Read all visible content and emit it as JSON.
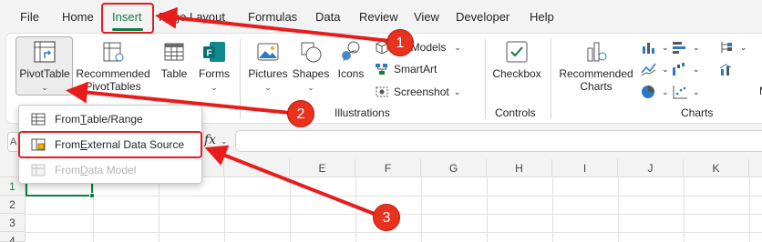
{
  "tabs": [
    "File",
    "Home",
    "Insert",
    "Page Layout",
    "Formulas",
    "Data",
    "Review",
    "View",
    "Developer",
    "Help"
  ],
  "active_tab": "Insert",
  "ribbon": {
    "pivot_table": "PivotTable",
    "recommended_pivot_line1": "Recommended",
    "recommended_pivot_line2": "PivotTables",
    "table": "Table",
    "forms": "Forms",
    "pictures": "Pictures",
    "shapes": "Shapes",
    "icons": "Icons",
    "models_3d": "3D Models",
    "smartart": "SmartArt",
    "screenshot": "Screenshot",
    "illustrations_group": "Illustrations",
    "checkbox": "Checkbox",
    "controls_group": "Controls",
    "recommended_charts_line1": "Recommended",
    "recommended_charts_line2": "Charts",
    "charts_group": "Charts",
    "partial_letter": "M"
  },
  "pivot_menu": {
    "items": [
      {
        "pre": "From ",
        "u": "T",
        "post": "able/Range",
        "enabled": true
      },
      {
        "pre": "From ",
        "u": "E",
        "post": "xternal Data Source",
        "enabled": true
      },
      {
        "pre": "From ",
        "u": "D",
        "post": "ata Model",
        "enabled": false
      }
    ]
  },
  "formula_bar": {
    "namebox_partial": "A",
    "fx": "fx"
  },
  "grid": {
    "columns": [
      "E",
      "F",
      "G",
      "H",
      "I",
      "J",
      "K"
    ],
    "rows": [
      "1",
      "2",
      "3",
      "4"
    ]
  },
  "annotations": {
    "step1": "1",
    "step2": "2",
    "step3": "3"
  },
  "colors": {
    "accent_green": "#107c41",
    "annotation_red": "#e81c1c"
  }
}
